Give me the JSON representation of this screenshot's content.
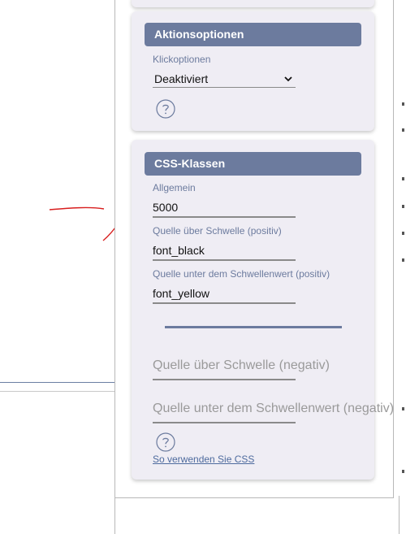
{
  "actions_card": {
    "header": "Aktionsoptionen",
    "click_label": "Klickoptionen",
    "click_value": "Deaktiviert"
  },
  "css_card": {
    "header": "CSS-Klassen",
    "general_label": "Allgemein",
    "general_value": "5000",
    "above_pos_label": "Quelle über Schwelle (positiv)",
    "above_pos_value": "font_black",
    "below_pos_label": "Quelle unter dem Schwellenwert (positiv)",
    "below_pos_value": "font_yellow",
    "above_neg_placeholder": "Quelle über Schwelle (negativ)",
    "below_neg_placeholder": "Quelle unter dem Schwellenwert (negativ)",
    "css_help_link": "So verwenden Sie CSS"
  },
  "colors": {
    "header_bg": "#6c7b9e",
    "card_bg": "#efedf4",
    "annotation": "#d81e1e"
  },
  "icons": [
    "chevron-down-icon",
    "help-circle-icon"
  ]
}
